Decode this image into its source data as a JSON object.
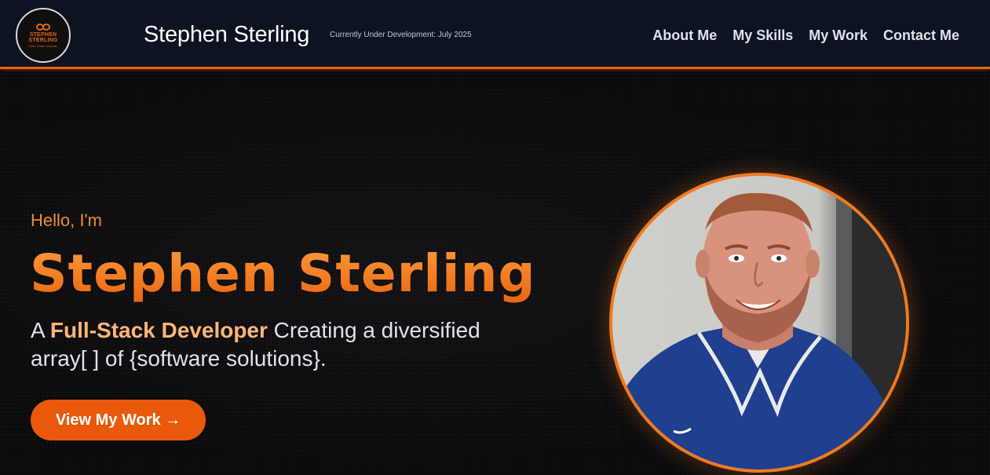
{
  "header": {
    "logo": {
      "line1": "STEPHEN",
      "line2": "STERLING",
      "tagline": "Code. Create. Innovate."
    },
    "brand_name": "Stephen Sterling",
    "dev_note": "Currently Under Development: July 2025",
    "nav": [
      {
        "label": "About Me"
      },
      {
        "label": "My Skills"
      },
      {
        "label": "My Work"
      },
      {
        "label": "Contact Me"
      }
    ]
  },
  "hero": {
    "greeting": "Hello, I'm",
    "name": "Stephen Sterling",
    "tagline_prefix": "A ",
    "tagline_highlight": "Full-Stack Developer",
    "tagline_suffix": " Creating a diversified array[ ] of {software solutions}.",
    "cta_label": "View My Work →"
  },
  "portrait": {
    "alt": "profile-photo"
  },
  "colors": {
    "accent": "#e8640f",
    "header_bg": "#0d1320",
    "page_bg": "#0b0b0d",
    "highlight": "#ffb778"
  }
}
